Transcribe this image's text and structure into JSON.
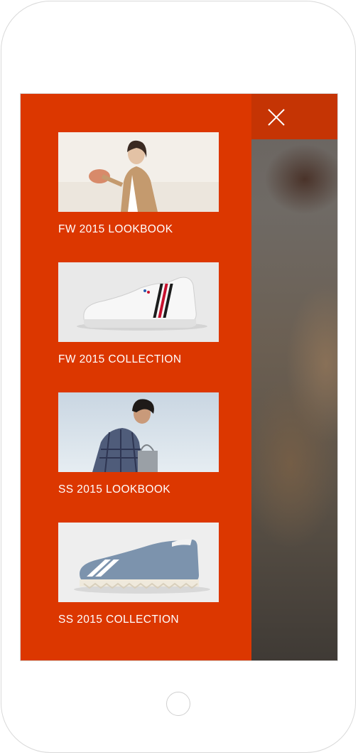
{
  "header": {
    "close_icon": "close-icon",
    "accent_color": "#dc3700",
    "topbar_color": "#c53404"
  },
  "menu": {
    "items": [
      {
        "label": "FW 2015 LOOKBOOK",
        "image": "woman-in-trench-coat"
      },
      {
        "label": "FW 2015 COLLECTION",
        "image": "white-sneaker-striped"
      },
      {
        "label": "SS 2015 LOOKBOOK",
        "image": "man-in-plaid-shirt"
      },
      {
        "label": "SS 2015 COLLECTION",
        "image": "blue-suede-sneaker"
      }
    ]
  },
  "device": {
    "home_button": "home-button"
  }
}
